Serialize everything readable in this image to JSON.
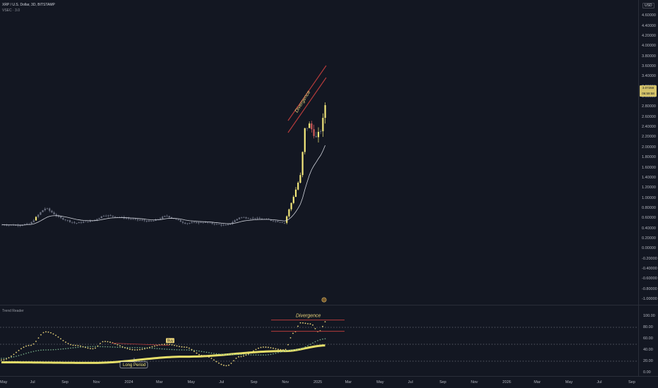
{
  "header": {
    "symbol_line": "XRP / U.S. Dollar, 3D, BITSTAMP",
    "indicator_line": "VSEC · 3.0",
    "currency": "USD",
    "last_price": "3.07268",
    "countdown": "06:59:58"
  },
  "indicator": {
    "name": "Trend Reader"
  },
  "annotations": {
    "divergence_main": "Divergence",
    "divergence_indicator": "Divergence",
    "long_period": "Long Period",
    "buy": "Buy"
  },
  "colors": {
    "background": "#131722",
    "grid": "#2a2e39",
    "up_candle": "#f3e77a",
    "down_candle": "#d35a5a",
    "neutral_candle": "#6b7080",
    "channel": "#b53b3b",
    "yellow_dots": "#e9d47a",
    "green_dots": "#78b08a",
    "long_period_line": "#e6df6a"
  },
  "chart_data": [
    {
      "type": "candlestick",
      "title": "XRP / U.S. Dollar, 3D, BITSTAMP",
      "ylim": [
        -1.0,
        4.8
      ],
      "y_ticks": [
        "4.60000",
        "4.40000",
        "4.20000",
        "4.00000",
        "3.80000",
        "3.60000",
        "3.40000",
        "3.20000",
        "3.00000",
        "2.80000",
        "2.60000",
        "2.40000",
        "2.20000",
        "2.00000",
        "1.80000",
        "1.60000",
        "1.40000",
        "1.20000",
        "1.00000",
        "0.80000",
        "0.60000",
        "0.40000",
        "0.20000",
        "0.00000",
        "-0.20000",
        "-0.40000",
        "-0.60000",
        "-0.80000",
        "-1.00000"
      ],
      "x_ticks": [
        "May",
        "Jul",
        "Sep",
        "Nov",
        "2024",
        "Mar",
        "May",
        "Jul",
        "Sep",
        "Nov",
        "2025",
        "Mar",
        "May",
        "Jul",
        "Sep",
        "Nov",
        "2026",
        "Mar",
        "May",
        "Jul",
        "Sep"
      ],
      "series": [
        {
          "name": "Price",
          "points": [
            {
              "x": "2023-04-25",
              "close": 0.47
            },
            {
              "x": "2023-05-25",
              "close": 0.46
            },
            {
              "x": "2023-06-20",
              "close": 0.49
            },
            {
              "x": "2023-07-13",
              "close": 0.75
            },
            {
              "x": "2023-07-20",
              "close": 0.8
            },
            {
              "x": "2023-08-15",
              "close": 0.61
            },
            {
              "x": "2023-09-15",
              "close": 0.5
            },
            {
              "x": "2023-10-20",
              "close": 0.55
            },
            {
              "x": "2023-11-10",
              "close": 0.66
            },
            {
              "x": "2023-12-10",
              "close": 0.62
            },
            {
              "x": "2024-01-10",
              "close": 0.57
            },
            {
              "x": "2024-02-10",
              "close": 0.53
            },
            {
              "x": "2024-03-10",
              "close": 0.65
            },
            {
              "x": "2024-04-15",
              "close": 0.5
            },
            {
              "x": "2024-05-20",
              "close": 0.52
            },
            {
              "x": "2024-07-05",
              "close": 0.45
            },
            {
              "x": "2024-07-30",
              "close": 0.62
            },
            {
              "x": "2024-09-15",
              "close": 0.58
            },
            {
              "x": "2024-10-25",
              "close": 0.51
            },
            {
              "x": "2024-11-12",
              "close": 1.05
            },
            {
              "x": "2024-11-25",
              "close": 1.45
            },
            {
              "x": "2024-12-03",
              "close": 2.35
            },
            {
              "x": "2024-12-12",
              "close": 2.45
            },
            {
              "x": "2024-12-25",
              "close": 2.18
            },
            {
              "x": "2025-01-05",
              "close": 2.38
            },
            {
              "x": "2025-01-15",
              "close": 3.07
            }
          ]
        }
      ]
    },
    {
      "type": "line",
      "title": "Trend Reader",
      "ylim": [
        0,
        100
      ],
      "y_ticks": [
        "100.00",
        "80.00",
        "60.00",
        "40.00",
        "20.00",
        "0.00"
      ],
      "series": [
        {
          "name": "yellow-dots",
          "points": [
            {
              "x": "2023-04-25",
              "y": 22
            },
            {
              "x": "2023-06-20",
              "y": 48
            },
            {
              "x": "2023-07-20",
              "y": 72
            },
            {
              "x": "2023-09-15",
              "y": 48
            },
            {
              "x": "2023-10-20",
              "y": 42
            },
            {
              "x": "2023-11-10",
              "y": 55
            },
            {
              "x": "2024-01-10",
              "y": 40
            },
            {
              "x": "2024-03-10",
              "y": 50
            },
            {
              "x": "2024-04-15",
              "y": 45
            },
            {
              "x": "2024-05-20",
              "y": 30
            },
            {
              "x": "2024-07-05",
              "y": 12
            },
            {
              "x": "2024-07-30",
              "y": 28
            },
            {
              "x": "2024-09-15",
              "y": 45
            },
            {
              "x": "2024-10-25",
              "y": 40
            },
            {
              "x": "2024-11-12",
              "y": 70
            },
            {
              "x": "2024-11-25",
              "y": 88
            },
            {
              "x": "2024-12-15",
              "y": 86
            },
            {
              "x": "2024-12-30",
              "y": 72
            },
            {
              "x": "2025-01-15",
              "y": 92
            }
          ]
        },
        {
          "name": "green-dots",
          "points": [
            {
              "x": "2023-04-25",
              "y": 25
            },
            {
              "x": "2023-07-20",
              "y": 40
            },
            {
              "x": "2023-10-20",
              "y": 46
            },
            {
              "x": "2024-01-10",
              "y": 44
            },
            {
              "x": "2024-04-15",
              "y": 40
            },
            {
              "x": "2024-07-05",
              "y": 32
            },
            {
              "x": "2024-09-15",
              "y": 31
            },
            {
              "x": "2024-11-12",
              "y": 40
            },
            {
              "x": "2025-01-15",
              "y": 60
            }
          ]
        },
        {
          "name": "long-period",
          "points": [
            {
              "x": "2023-04-25",
              "y": 18
            },
            {
              "x": "2023-10-20",
              "y": 17
            },
            {
              "x": "2024-04-15",
              "y": 28
            },
            {
              "x": "2024-10-25",
              "y": 38
            },
            {
              "x": "2025-01-15",
              "y": 48
            }
          ]
        }
      ]
    }
  ]
}
